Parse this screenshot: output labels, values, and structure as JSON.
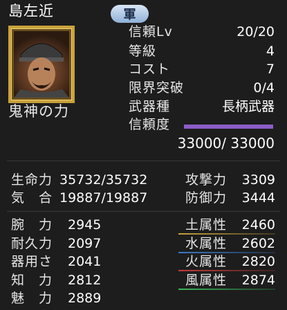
{
  "header": {
    "name": "島左近",
    "badge": "軍",
    "skill": "鬼神の力"
  },
  "stats_top": [
    {
      "label": "信頼Lv",
      "value": "20/20"
    },
    {
      "label": "等級",
      "value": "4"
    },
    {
      "label": "コスト",
      "value": "7"
    },
    {
      "label": "限界突破",
      "value": "0/4"
    },
    {
      "label": "武器種",
      "value": "長柄武器"
    },
    {
      "label": "信頼度",
      "value": "33000/ 33000",
      "progress": 1.0,
      "bar_color": "#8c5cc8"
    }
  ],
  "stats_mid_left": [
    {
      "label": "生命力",
      "value": "35732/35732"
    },
    {
      "label": "気　合",
      "value": "19887/19887"
    }
  ],
  "stats_mid_right": [
    {
      "label": "攻撃力",
      "value": "3309"
    },
    {
      "label": "防御力",
      "value": "3444"
    }
  ],
  "stats_bottom_left": [
    {
      "label": "腕　力",
      "value": "2945"
    },
    {
      "label": "耐久力",
      "value": "2097"
    },
    {
      "label": "器用さ",
      "value": "2041"
    },
    {
      "label": "知　力",
      "value": "2812"
    },
    {
      "label": "魅　力",
      "value": "2889"
    }
  ],
  "attributes": [
    {
      "label": "土属性",
      "value": "2460",
      "color": "#c8a23a"
    },
    {
      "label": "水属性",
      "value": "2602",
      "color": "#3a7ac8"
    },
    {
      "label": "火属性",
      "value": "2820",
      "color": "#c83a3a"
    },
    {
      "label": "風属性",
      "value": "2874",
      "color": "#3ab85a"
    }
  ]
}
